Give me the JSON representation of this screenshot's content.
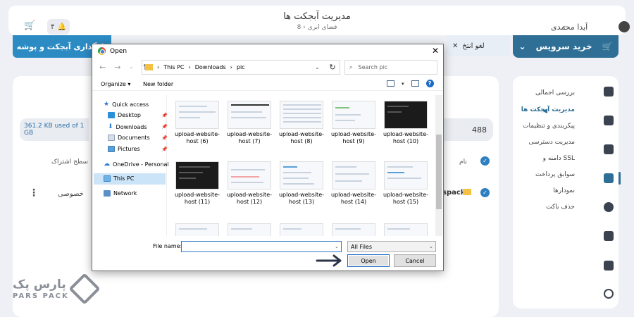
{
  "app": {
    "page_title": "مدیریت آبجکت ها",
    "breadcrumb": "فضای ابری",
    "breadcrumb_sep": "›",
    "breadcrumb_id": "8",
    "user_name": "آیدا محمدی",
    "notification_count": "۴",
    "service_button": "خرید سرویس",
    "upload_button": "بارگذاری آبجکت و پوشه",
    "cancel_label": "لغو انتخ",
    "storage_usage": "361.2 KB used of 1 GB",
    "bucket_id": "488",
    "columns": {
      "access": "سطح اشتراک",
      "name": "نام"
    },
    "row": {
      "access": "خصوصی",
      "name": "spack"
    },
    "logo": {
      "name": "پارس پک",
      "sub": "PARS PACK"
    },
    "sidebar": [
      "بررسی اجمالی",
      "مدیریت آبجکت ها",
      "پیکربندی و تنظیمات",
      "مدیریت دسترسی",
      "دامنه و SSL",
      "سوابق پرداخت",
      "نمودارها",
      "حذف باکت"
    ]
  },
  "dialog": {
    "title": "Open",
    "close": "✕",
    "path": [
      "This PC",
      "Downloads",
      "pic"
    ],
    "path_sep": "›",
    "search_placeholder": "Search pic",
    "organize": "Organize ▾",
    "new_folder": "New folder",
    "nav": {
      "quick_access": "Quick access",
      "desktop": "Desktop",
      "downloads": "Downloads",
      "documents": "Documents",
      "pictures": "Pictures",
      "onedrive": "OneDrive - Personal",
      "this_pc": "This PC",
      "network": "Network"
    },
    "files": [
      "upload-website-host (6)",
      "upload-website-host (7)",
      "upload-website-host (8)",
      "upload-website-host (9)",
      "upload-website-host (10)",
      "upload-website-host (11)",
      "upload-website-host (12)",
      "upload-website-host (13)",
      "upload-website-host (14)",
      "upload-website-host (15)"
    ],
    "file_name_label": "File name:",
    "file_name_value": "",
    "file_type": "All Files",
    "open_button": "Open",
    "cancel_button": "Cancel"
  },
  "colors": {
    "accent": "#2f6f96",
    "upload": "#2d8bc4"
  }
}
